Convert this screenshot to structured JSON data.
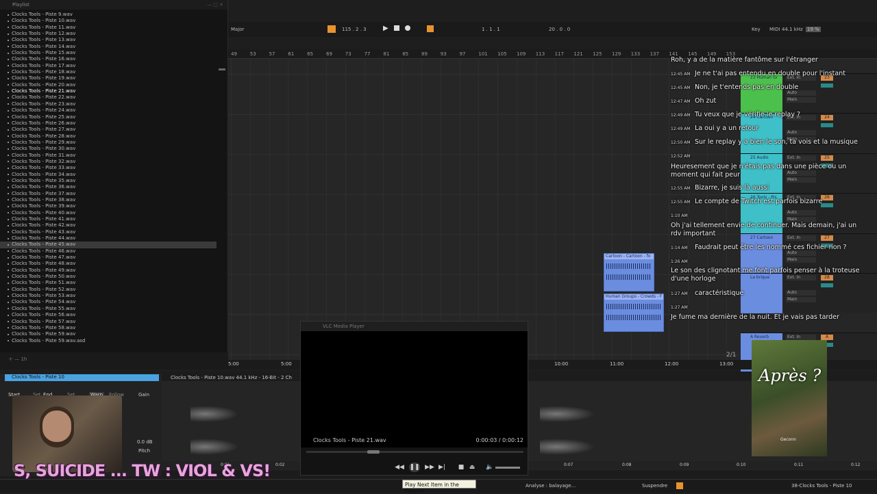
{
  "playlist": {
    "title": "Playlist",
    "items": [
      "Clocks Tools - Piste  9.wav",
      "Clocks Tools - Piste 10.wav",
      "Clocks Tools - Piste 11.wav",
      "Clocks Tools - Piste 12.wav",
      "Clocks Tools - Piste 13.wav",
      "Clocks Tools - Piste 14.wav",
      "Clocks Tools - Piste 15.wav",
      "Clocks Tools - Piste 16.wav",
      "Clocks Tools - Piste 17.wav",
      "Clocks Tools - Piste 18.wav",
      "Clocks Tools - Piste 19.wav",
      "Clocks Tools - Piste 20.wav",
      "Clocks Tools - Piste 21.wav",
      "Clocks Tools - Piste 22.wav",
      "Clocks Tools - Piste 23.wav",
      "Clocks Tools - Piste 24.wav",
      "Clocks Tools - Piste 25.wav",
      "Clocks Tools - Piste 26.wav",
      "Clocks Tools - Piste 27.wav",
      "Clocks Tools - Piste 28.wav",
      "Clocks Tools - Piste 29.wav",
      "Clocks Tools - Piste 30.wav",
      "Clocks Tools - Piste 31.wav",
      "Clocks Tools - Piste 32.wav",
      "Clocks Tools - Piste 33.wav",
      "Clocks Tools - Piste 34.wav",
      "Clocks Tools - Piste 35.wav",
      "Clocks Tools - Piste 36.wav",
      "Clocks Tools - Piste 37.wav",
      "Clocks Tools - Piste 38.wav",
      "Clocks Tools - Piste 39.wav",
      "Clocks Tools - Piste 40.wav",
      "Clocks Tools - Piste 41.wav",
      "Clocks Tools - Piste 42.wav",
      "Clocks Tools - Piste 43.wav",
      "Clocks Tools - Piste 44.wav",
      "Clocks Tools - Piste 45.wav",
      "Clocks Tools - Piste 46.wav",
      "Clocks Tools - Piste 47.wav",
      "Clocks Tools - Piste 48.wav",
      "Clocks Tools - Piste 49.wav",
      "Clocks Tools - Piste 50.wav",
      "Clocks Tools - Piste 51.wav",
      "Clocks Tools - Piste 52.wav",
      "Clocks Tools - Piste 53.wav",
      "Clocks Tools - Piste 54.wav",
      "Clocks Tools - Piste 55.wav",
      "Clocks Tools - Piste 56.wav",
      "Clocks Tools - Piste 57.wav",
      "Clocks Tools - Piste 58.wav",
      "Clocks Tools - Piste 59.wav",
      "Clocks Tools - Piste 59.wav.asd"
    ],
    "playing_index": 12,
    "selected_index": 36,
    "footer": "1h"
  },
  "daw": {
    "scale": "Major",
    "tempo_pos": "115 .  2 .  3",
    "loop_pos": "1 .  1 .  1",
    "loop_len": "20 .  0 .  0",
    "key_label": "Key",
    "midi_label": "MIDI",
    "sample_rate": "44.1 kHz",
    "cpu": "19 %",
    "ruler": [
      "49",
      "53",
      "57",
      "61",
      "65",
      "69",
      "73",
      "77",
      "81",
      "85",
      "89",
      "93",
      "97",
      "101",
      "105",
      "109",
      "113",
      "117",
      "121",
      "125",
      "129",
      "133",
      "137",
      "141",
      "145",
      "149",
      "153"
    ],
    "time_ruler": [
      "5:00",
      "10:00",
      "11:00",
      "12:00",
      "13:00"
    ],
    "page_indicator": "2/1",
    "clips": [
      {
        "title": "Cartoon - Cartoon - fo"
      },
      {
        "title": "Human Groups - Crowds - F"
      }
    ],
    "tracks": [
      {
        "name": "23 Human Gr",
        "color": "#4cc04c",
        "num": "23"
      },
      {
        "name": "24 Cartoon",
        "color": "#3fc0c8",
        "num": "24"
      },
      {
        "name": "25 Audio",
        "color": "#3fc0c8",
        "num": "25"
      },
      {
        "name": "26 Tools - Pis",
        "color": "#3fc0c8",
        "num": "26"
      },
      {
        "name": "27 Cartoon",
        "color": "#6a8de0",
        "num": "27"
      },
      {
        "name": "La brique",
        "color": "#6a8de0",
        "num": "28"
      },
      {
        "name": "A Reverb",
        "color": "#6a8de0",
        "num": "A"
      }
    ],
    "io_in": "Ext. In",
    "io_auto": "Auto",
    "io_off": "Off",
    "io_main": "Main"
  },
  "chat": [
    {
      "time": "",
      "text": "Roh, y a de la matière fantôme sur l'étranger"
    },
    {
      "time": "12:45 AM",
      "text": "Je ne t'ai pas entendu en double pour l'instant"
    },
    {
      "time": "12:45 AM",
      "text": "Non, je t'entends pas en double"
    },
    {
      "time": "12:47 AM",
      "text": "Oh zut"
    },
    {
      "time": "12:49 AM",
      "text": "Tu veux que je vérifie le replay ?"
    },
    {
      "time": "12:49 AM",
      "text": "La oui y a un retour"
    },
    {
      "time": "12:50 AM",
      "text": "Sur le replay y a bien le son, ta vois et la musique"
    },
    {
      "time": "12:52 AM",
      "text": ""
    },
    {
      "time": "",
      "text": "Heuresement que je n'étais pas dans une pièce ou un moment qui fait peur"
    },
    {
      "time": "12:55 AM",
      "text": "Bizarre, je suis là aussi"
    },
    {
      "time": "12:55 AM",
      "text": "Le compte de Twitch est parfois bizarre"
    },
    {
      "time": "1:10 AM",
      "text": ""
    },
    {
      "time": "",
      "text": "Oh j'ai tellement envie de continuer. Mais demain, j'ai un rdv important"
    },
    {
      "time": "1:14 AM",
      "text": "Faudrait peut être les nommé ces fichier non ?"
    },
    {
      "time": "1:26 AM",
      "text": ""
    },
    {
      "time": "",
      "text": "Le son des clignotant me font parfois penser à la troteuse d'une horloge"
    },
    {
      "time": "1:27 AM",
      "text": "caractéristique"
    },
    {
      "time": "1:27 AM",
      "text": ""
    },
    {
      "time": "",
      "text": "Je fume ma dernière de la nuit. Et je vais pas tarder"
    }
  ],
  "clipview": {
    "title": "Clocks Tools - Piste 10",
    "info": "Clocks Tools - Piste 10.wav  44.1 kHz - 16-Bit - 2 Ch",
    "start": "Start",
    "end": "End",
    "set": "Set",
    "warp": "Warp",
    "follow": "Follow",
    "gain": "Gain",
    "gain_db": "0.0 dB",
    "pitch": "Pitch",
    "timeline": [
      "0:01",
      "0:02",
      "0:07",
      "0:08",
      "0:09",
      "0:10",
      "0:11",
      "0:12"
    ]
  },
  "vlc": {
    "title": "VLC Media Player",
    "file": "Clocks Tools - Piste 21.wav",
    "time": "0:00:03 / 0:00:12",
    "progress": 0.25,
    "tooltip": "Play Next Item in the Playlist"
  },
  "overlay": {
    "banner": "S, SUICIDE ... TW : VIOL & VS!",
    "book_title": "Après ?",
    "book_author": "Geconn"
  },
  "status": {
    "analysis": "Analyse : balayage...",
    "suspend": "Suspendre",
    "track": "38-Clocks Tools - Piste 10"
  }
}
